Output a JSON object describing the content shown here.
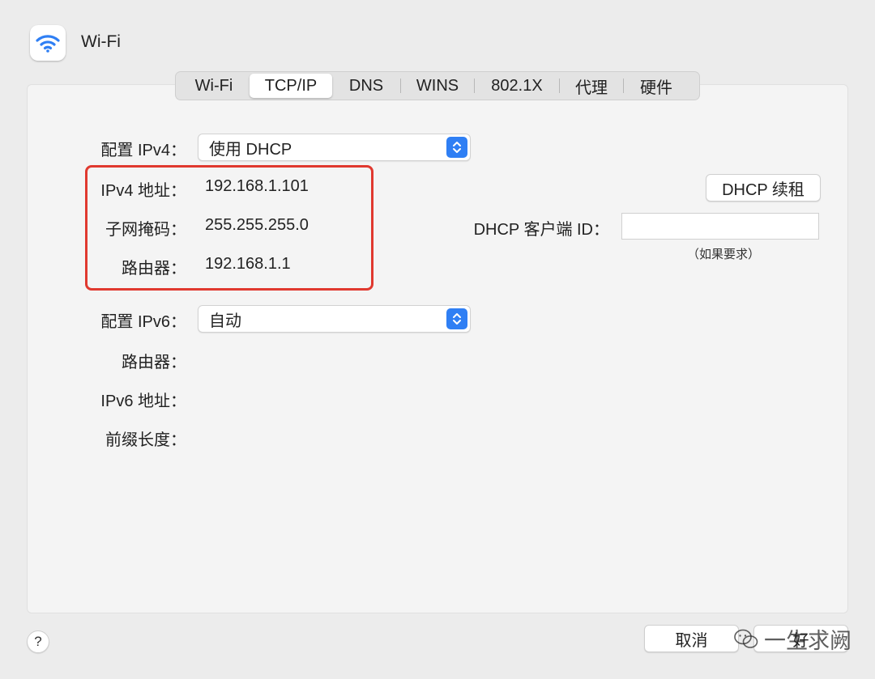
{
  "window": {
    "title": "Wi-Fi"
  },
  "tabs": [
    {
      "label": "Wi-Fi",
      "active": false
    },
    {
      "label": "TCP/IP",
      "active": true
    },
    {
      "label": "DNS",
      "active": false
    },
    {
      "label": "WINS",
      "active": false
    },
    {
      "label": "802.1X",
      "active": false
    },
    {
      "label": "代理",
      "active": false
    },
    {
      "label": "硬件",
      "active": false
    }
  ],
  "ipv4": {
    "config_label": "配置 IPv4：",
    "config_value": "使用 DHCP",
    "address_label": "IPv4 地址：",
    "address_value": "192.168.1.101",
    "subnet_label": "子网掩码：",
    "subnet_value": "255.255.255.0",
    "router_label": "路由器：",
    "router_value": "192.168.1.1"
  },
  "dhcp": {
    "renew_button": "DHCP 续租",
    "client_id_label": "DHCP 客户端 ID：",
    "client_id_value": "",
    "client_id_hint": "（如果要求）"
  },
  "ipv6": {
    "config_label": "配置 IPv6：",
    "config_value": "自动",
    "router_label": "路由器：",
    "address_label": "IPv6 地址：",
    "prefix_label": "前缀长度："
  },
  "footer": {
    "help_label": "?",
    "cancel_label": "取消",
    "ok_label": "好"
  },
  "watermark": {
    "text": "一生求阙"
  },
  "colors": {
    "accent": "#2f7ff4",
    "highlight_border": "#e0392f",
    "wifi_icon": "#2f7ff4"
  }
}
